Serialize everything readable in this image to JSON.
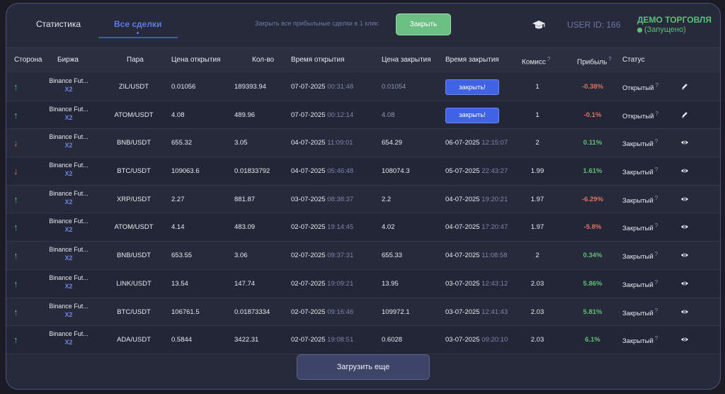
{
  "tabs": [
    {
      "label": "Статистика",
      "active": false
    },
    {
      "label": "Все сделки",
      "active": true
    }
  ],
  "close_all": {
    "hint": "Закрыть все прибыльные сделки в 1 клик:",
    "button_label": "Закрыть"
  },
  "user": {
    "id_label": "USER ID: 166"
  },
  "demo": {
    "title": "ДЕМО ТОРГОВЛЯ",
    "status": "(Запущено)"
  },
  "columns": [
    "Сторона",
    "Биржа",
    "Пара",
    "Цена открытия",
    "Кол-во",
    "Время открытия",
    "Цена закрытия",
    "Время закрытия",
    "Комисс",
    "Прибыль",
    "Статус"
  ],
  "help_mark": "?",
  "close_button_label": "закрыть!",
  "colors": {
    "accent": "#3f63e2",
    "profit": "#5fbf78",
    "loss": "#e0735e",
    "panel": "#262a3a"
  },
  "trades": [
    {
      "side": "up",
      "exchange": "Binance Fut...",
      "leverage": "X2",
      "pair": "ZIL/USDT",
      "open_price": "0.01056",
      "qty": "189393.94",
      "open_date": "07-07-2025",
      "open_time": "00:31:48",
      "close_price": "0.01054",
      "close_date": "",
      "close_time": "",
      "fee": "1",
      "profit": "-0.38%",
      "profit_sign": "neg",
      "status": "Открытый",
      "action": "edit-icon"
    },
    {
      "side": "up",
      "exchange": "Binance Fut...",
      "leverage": "X2",
      "pair": "ATOM/USDT",
      "open_price": "4.08",
      "qty": "489.96",
      "open_date": "07-07-2025",
      "open_time": "00:12:14",
      "close_price": "4.08",
      "close_date": "",
      "close_time": "",
      "fee": "1",
      "profit": "-0.1%",
      "profit_sign": "neg",
      "status": "Открытый",
      "action": "edit-icon"
    },
    {
      "side": "down",
      "exchange": "Binance Fut...",
      "leverage": "X2",
      "pair": "BNB/USDT",
      "open_price": "655.32",
      "qty": "3.05",
      "open_date": "04-07-2025",
      "open_time": "11:09:01",
      "close_price": "654.29",
      "close_date": "06-07-2025",
      "close_time": "12:15:07",
      "fee": "2",
      "profit": "0.11%",
      "profit_sign": "pos",
      "status": "Закрытый",
      "action": "eye-icon"
    },
    {
      "side": "down",
      "exchange": "Binance Fut...",
      "leverage": "X2",
      "pair": "BTC/USDT",
      "open_price": "109063.6",
      "qty": "0.01833792",
      "open_date": "04-07-2025",
      "open_time": "05:46:48",
      "close_price": "108074.3",
      "close_date": "05-07-2025",
      "close_time": "22:43:27",
      "fee": "1.99",
      "profit": "1.61%",
      "profit_sign": "pos",
      "status": "Закрытый",
      "action": "eye-icon"
    },
    {
      "side": "up",
      "exchange": "Binance Fut...",
      "leverage": "X2",
      "pair": "XRP/USDT",
      "open_price": "2.27",
      "qty": "881.87",
      "open_date": "03-07-2025",
      "open_time": "08:38:37",
      "close_price": "2.2",
      "close_date": "04-07-2025",
      "close_time": "19:20:21",
      "fee": "1.97",
      "profit": "-6.29%",
      "profit_sign": "neg",
      "status": "Закрытый",
      "action": "eye-icon"
    },
    {
      "side": "up",
      "exchange": "Binance Fut...",
      "leverage": "X2",
      "pair": "ATOM/USDT",
      "open_price": "4.14",
      "qty": "483.09",
      "open_date": "02-07-2025",
      "open_time": "19:14:45",
      "close_price": "4.02",
      "close_date": "04-07-2025",
      "close_time": "17:20:47",
      "fee": "1.97",
      "profit": "-5.8%",
      "profit_sign": "neg",
      "status": "Закрытый",
      "action": "eye-icon"
    },
    {
      "side": "up",
      "exchange": "Binance Fut...",
      "leverage": "X2",
      "pair": "BNB/USDT",
      "open_price": "653.55",
      "qty": "3.06",
      "open_date": "02-07-2025",
      "open_time": "09:37:31",
      "close_price": "655.33",
      "close_date": "04-07-2025",
      "close_time": "11:08:58",
      "fee": "2",
      "profit": "0.34%",
      "profit_sign": "pos",
      "status": "Закрытый",
      "action": "eye-icon"
    },
    {
      "side": "up",
      "exchange": "Binance Fut...",
      "leverage": "X2",
      "pair": "LINK/USDT",
      "open_price": "13.54",
      "qty": "147.74",
      "open_date": "02-07-2025",
      "open_time": "19:09:21",
      "close_price": "13.95",
      "close_date": "03-07-2025",
      "close_time": "12:43:12",
      "fee": "2.03",
      "profit": "5.86%",
      "profit_sign": "pos",
      "status": "Закрытый",
      "action": "eye-icon"
    },
    {
      "side": "up",
      "exchange": "Binance Fut...",
      "leverage": "X2",
      "pair": "BTC/USDT",
      "open_price": "106761.5",
      "qty": "0.01873334",
      "open_date": "02-07-2025",
      "open_time": "09:16:46",
      "close_price": "109972.1",
      "close_date": "03-07-2025",
      "close_time": "12:41:43",
      "fee": "2.03",
      "profit": "5.81%",
      "profit_sign": "pos",
      "status": "Закрытый",
      "action": "eye-icon"
    },
    {
      "side": "up",
      "exchange": "Binance Fut...",
      "leverage": "X2",
      "pair": "ADA/USDT",
      "open_price": "0.5844",
      "qty": "3422.31",
      "open_date": "02-07-2025",
      "open_time": "19:08:51",
      "close_price": "0.6028",
      "close_date": "03-07-2025",
      "close_time": "09:20:10",
      "fee": "2.03",
      "profit": "6.1%",
      "profit_sign": "pos",
      "status": "Закрытый",
      "action": "eye-icon"
    }
  ],
  "load_more_label": "Загрузить еще"
}
